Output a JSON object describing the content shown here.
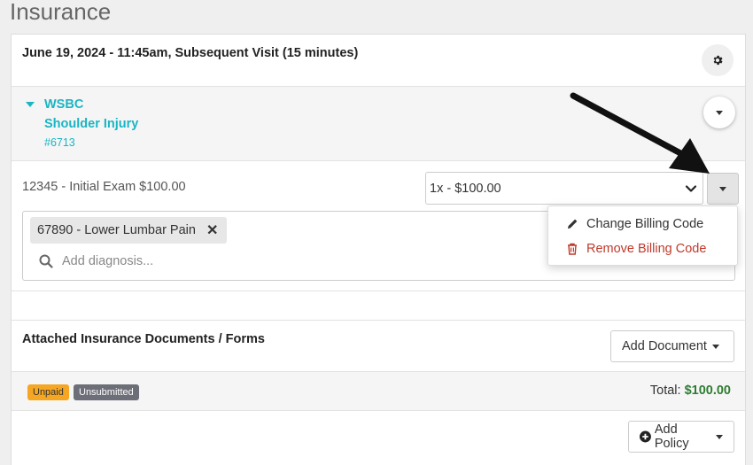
{
  "page": {
    "title": "Insurance"
  },
  "visit": {
    "title": "June 19, 2024 - 11:45am, Subsequent Visit (15 minutes)"
  },
  "case": {
    "name": "WSBC",
    "detail": "Shoulder Injury",
    "number": "#6713"
  },
  "billing": {
    "code_text": "12345 - Initial Exam $100.00",
    "qty_select": "1x - $100.00"
  },
  "diagnosis": {
    "tag": "67890 - Lower Lumbar Pain",
    "placeholder": "Add diagnosis..."
  },
  "dropdown": {
    "change_label": "Change Billing Code",
    "remove_label": "Remove Billing Code"
  },
  "documents": {
    "title": "Attached Insurance Documents / Forms",
    "add_label": "Add Document"
  },
  "status": {
    "unpaid": "Unpaid",
    "unsubmitted": "Unsubmitted",
    "total_label": "Total:",
    "total_amount": "$100.00"
  },
  "policy": {
    "add_label": "Add Policy"
  },
  "colors": {
    "accent": "#1bb5c4",
    "danger": "#c0392b",
    "money": "#2e7d32",
    "unpaid": "#f5a623",
    "unsubmitted": "#6c6e78"
  },
  "icons": [
    "gear-icon",
    "caret-down-icon",
    "chevron-down-icon",
    "close-icon",
    "search-icon",
    "pencil-icon",
    "trash-icon",
    "plus-circle-icon"
  ]
}
